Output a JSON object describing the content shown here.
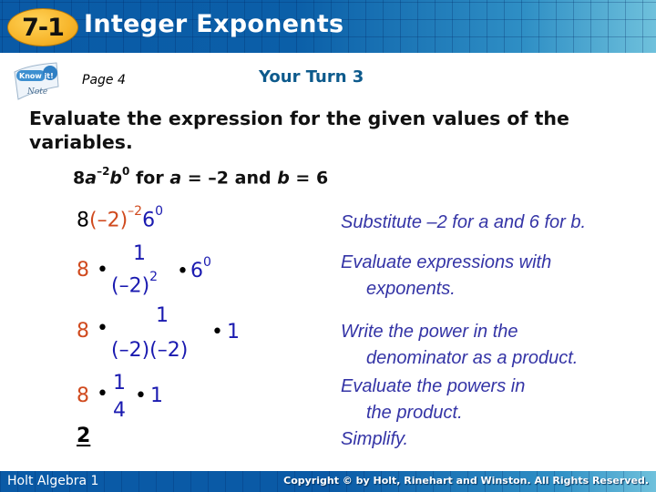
{
  "header": {
    "badge": "7-1",
    "title": "Integer Exponents"
  },
  "logo": {
    "top": "Know it!",
    "bottom": "Note"
  },
  "page_ref": "Page 4",
  "section_title": "Your Turn 3",
  "instructions": "Evaluate the expression for the given values of the variables.",
  "problem": {
    "coef": "8",
    "var_a": "a",
    "exp_a": "–2",
    "var_b": "b",
    "exp_b": "0",
    "for_text": " for ",
    "a_label": "a",
    "a_value": " = –2 and ",
    "b_label": "b",
    "b_value": " = 6"
  },
  "steps": {
    "step1": {
      "coef": "8",
      "base": "(–2)",
      "exp": "–2",
      "b": "6",
      "b_exp": "0"
    },
    "step2": {
      "coef": "8",
      "dot": "•",
      "num": "1",
      "den_base": "(–2)",
      "den_exp": "2",
      "dot2": "•",
      "b": "6",
      "b_exp": "0"
    },
    "step3": {
      "coef": "8",
      "dot": "•",
      "num": "1",
      "den": "(–2)(–2)",
      "dot2": "•",
      "val": "1"
    },
    "step4": {
      "coef": "8",
      "dot": "•",
      "num": "1",
      "den": "4",
      "dot2": "•",
      "val": "1"
    },
    "answer": "2"
  },
  "explanations": [
    {
      "line1": "Substitute –2 for a and 6 for b.",
      "line2": ""
    },
    {
      "line1": "Evaluate expressions with",
      "line2": "exponents."
    },
    {
      "line1": "Write the power in the",
      "line2": "denominator as a product."
    },
    {
      "line1": "Evaluate the powers in",
      "line2": "the product."
    },
    {
      "line1": "Simplify.",
      "line2": ""
    }
  ],
  "footer": {
    "left": "Holt Algebra 1",
    "right": "Copyright © by Holt, Rinehart and Winston. All Rights Reserved."
  },
  "colors": {
    "header_blue": "#0a5aa6",
    "badge_gold": "#f7b52a",
    "title_blue": "#0d5a8c",
    "math_red": "#d04a1e",
    "math_blue": "#1a1ab0",
    "explain_blue": "#3434a6"
  }
}
